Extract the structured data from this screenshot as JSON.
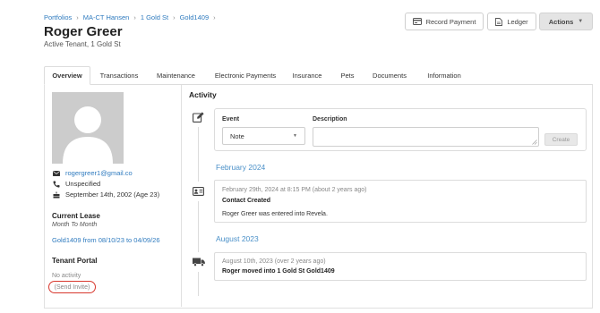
{
  "breadcrumb": [
    "Portfolios",
    "MA-CT Hansen",
    "1 Gold St",
    "Gold1409"
  ],
  "header": {
    "title": "Roger Greer",
    "subtitle": "Active Tenant, 1 Gold St",
    "record_payment_label": "Record Payment",
    "ledger_label": "Ledger",
    "actions_label": "Actions"
  },
  "tabs": [
    "Overview",
    "Transactions",
    "Maintenance",
    "Electronic Payments",
    "Insurance",
    "Pets",
    "Documents",
    "Information"
  ],
  "active_tab": "Overview",
  "profile": {
    "email": "rogergreer1@gmail.co",
    "phone": "Unspecified",
    "birthday": "September 14th, 2002 (Age 23)",
    "current_lease_heading": "Current Lease",
    "lease_type": "Month To Month",
    "lease_link": "Gold1409 from 08/10/23 to 04/09/26",
    "tenant_portal_heading": "Tenant Portal",
    "portal_status": "No activity",
    "send_invite_label": "(Send Invite)"
  },
  "activity": {
    "title": "Activity",
    "new_entry": {
      "event_label": "Event",
      "event_value": "Note",
      "description_label": "Description",
      "description_value": "",
      "create_label": "Create"
    },
    "groups": [
      {
        "month": "February 2024",
        "entries": [
          {
            "timestamp": "February 29th, 2024 at 8:15 PM (about 2 years ago)",
            "title": "Contact Created",
            "text": "Roger Greer was entered into Revela.",
            "icon": "id-card-icon"
          }
        ]
      },
      {
        "month": "August 2023",
        "entries": [
          {
            "timestamp": "August 10th, 2023 (over 2 years ago)",
            "title": "Roger moved into 1 Gold St Gold1409",
            "icon": "truck-icon"
          }
        ]
      }
    ]
  },
  "colors": {
    "link": "#2f7bbf",
    "month_heading": "#4a90c8",
    "invite_highlight": "#d8382e"
  }
}
